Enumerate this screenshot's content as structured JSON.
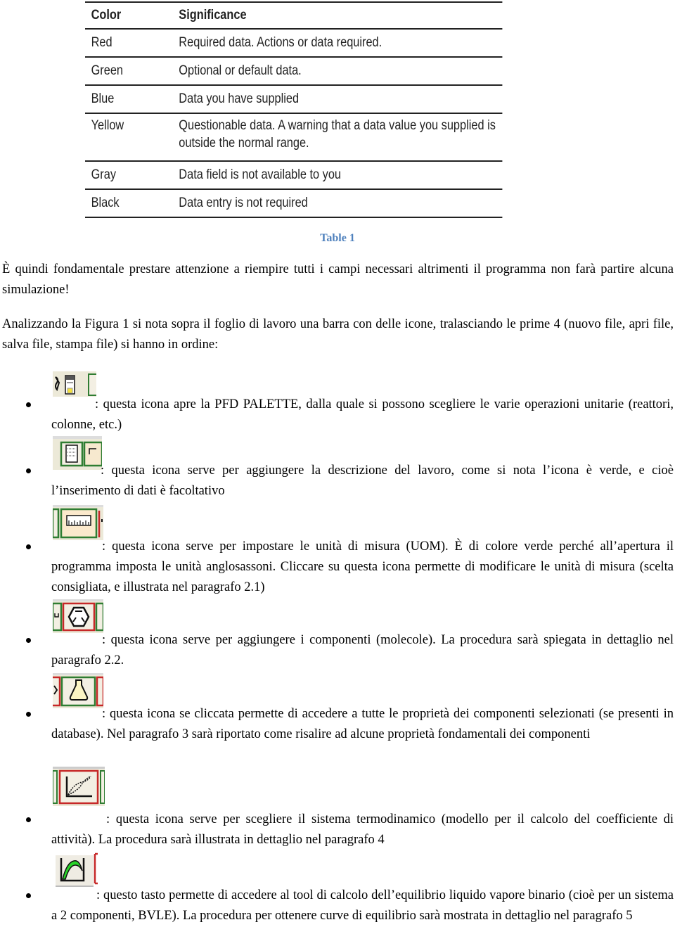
{
  "table": {
    "headers": [
      "Color",
      "Significance"
    ],
    "rows": [
      {
        "color": "Red",
        "significance": "Required data. Actions or data required."
      },
      {
        "color": "Green",
        "significance": "Optional or default data."
      },
      {
        "color": "Blue",
        "significance": "Data you have supplied"
      },
      {
        "color": "Yellow",
        "significance_line1": "Questionable data. A warning that a data value you supplied is",
        "significance_line2": "outside the normal range."
      },
      {
        "color": "Gray",
        "significance": "Data field is not available to you"
      },
      {
        "color": "Black",
        "significance": "Data entry is not required"
      }
    ],
    "caption": "Table 1"
  },
  "paragraphs": [
    "È quindi fondamentale prestare attenzione a riempire tutti i campi necessari altrimenti il programma non farà partire alcuna simulazione!",
    "Analizzando la Figura 1 si nota sopra il foglio di lavoro una barra con delle icone, tralasciando le prime 4 (nuovo file, apri file, salva file, stampa file) si hanno in ordine:"
  ],
  "bullets": [
    {
      "icon": "pfd-palette-icon",
      "text": ": questa icona apre la PFD PALETTE, dalla quale si possono scegliere le varie operazioni unitarie (reattori, colonne, etc.)"
    },
    {
      "icon": "description-icon",
      "text": ": questa icona serve per aggiungere la descrizione del lavoro, come si nota l’icona è verde, e cioè l’inserimento di dati è facoltativo"
    },
    {
      "icon": "ruler-uom-icon",
      "text": ": questa icona serve per impostare le unità di misura (UOM). È di colore verde perché all’apertura il programma imposta le unità anglosassoni. Cliccare su questa icona permette di modificare le unità di misura (scelta consigliata, e illustrata nel paragrafo 2.1)"
    },
    {
      "icon": "molecule-components-icon",
      "text": ": questa icona serve per aggiungere i componenti (molecole). La procedura sarà spiegata in dettaglio nel paragrafo 2.2."
    },
    {
      "icon": "flask-properties-icon",
      "text": ": questa icona se cliccata permette di accedere a tutte le proprietà dei componenti selezionati (se presenti in database). Nel paragrafo 3 sarà riportato come risalire ad alcune proprietà fondamentali dei componenti"
    },
    {
      "icon": "thermo-model-curve-icon",
      "text": ": questa icona serve per scegliere il sistema termodinamico (modello per il calcolo del coefficiente di attività). La procedura sarà illustrata in dettaglio nel paragrafo 4"
    },
    {
      "icon": "bvle-curve-icon",
      "text": ": questo tasto permette di accedere al tool di calcolo dell’equilibrio liquido vapore binario (cioè per un sistema a 2 componenti, BVLE). La procedura per ottenere curve di equilibrio sarà mostrata in dettaglio nel paragrafo 5"
    }
  ]
}
